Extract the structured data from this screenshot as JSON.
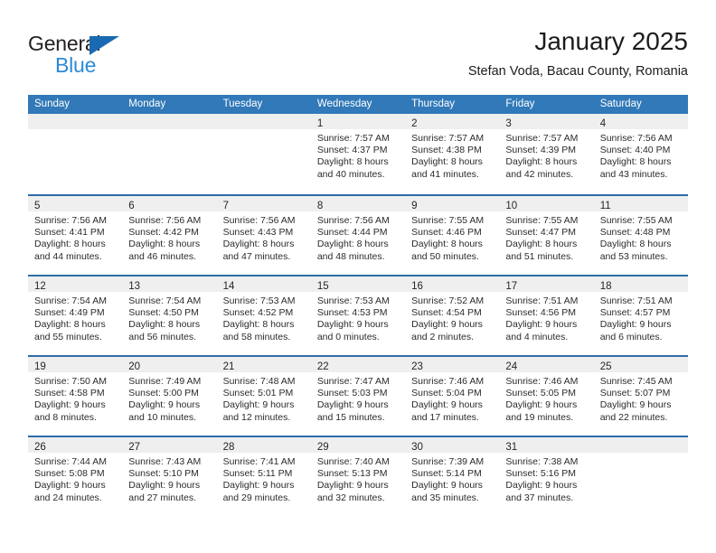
{
  "branding": {
    "name_part1": "General",
    "name_part2": "Blue",
    "triangle_color": "#1a6ab3",
    "blue_color": "#2b8ad6"
  },
  "header": {
    "title": "January 2025",
    "subtitle": "Stefan Voda, Bacau County, Romania"
  },
  "theme": {
    "header_row_bg": "#3179b8",
    "week_divider": "#2f6ca8",
    "day_bar_bg": "#efefef"
  },
  "weekdays": [
    "Sunday",
    "Monday",
    "Tuesday",
    "Wednesday",
    "Thursday",
    "Friday",
    "Saturday"
  ],
  "weeks": [
    [
      {
        "day": "",
        "empty": true
      },
      {
        "day": "",
        "empty": true
      },
      {
        "day": "",
        "empty": true
      },
      {
        "day": "1",
        "sunrise": "Sunrise: 7:57 AM",
        "sunset": "Sunset: 4:37 PM",
        "daylight1": "Daylight: 8 hours",
        "daylight2": "and 40 minutes."
      },
      {
        "day": "2",
        "sunrise": "Sunrise: 7:57 AM",
        "sunset": "Sunset: 4:38 PM",
        "daylight1": "Daylight: 8 hours",
        "daylight2": "and 41 minutes."
      },
      {
        "day": "3",
        "sunrise": "Sunrise: 7:57 AM",
        "sunset": "Sunset: 4:39 PM",
        "daylight1": "Daylight: 8 hours",
        "daylight2": "and 42 minutes."
      },
      {
        "day": "4",
        "sunrise": "Sunrise: 7:56 AM",
        "sunset": "Sunset: 4:40 PM",
        "daylight1": "Daylight: 8 hours",
        "daylight2": "and 43 minutes."
      }
    ],
    [
      {
        "day": "5",
        "sunrise": "Sunrise: 7:56 AM",
        "sunset": "Sunset: 4:41 PM",
        "daylight1": "Daylight: 8 hours",
        "daylight2": "and 44 minutes."
      },
      {
        "day": "6",
        "sunrise": "Sunrise: 7:56 AM",
        "sunset": "Sunset: 4:42 PM",
        "daylight1": "Daylight: 8 hours",
        "daylight2": "and 46 minutes."
      },
      {
        "day": "7",
        "sunrise": "Sunrise: 7:56 AM",
        "sunset": "Sunset: 4:43 PM",
        "daylight1": "Daylight: 8 hours",
        "daylight2": "and 47 minutes."
      },
      {
        "day": "8",
        "sunrise": "Sunrise: 7:56 AM",
        "sunset": "Sunset: 4:44 PM",
        "daylight1": "Daylight: 8 hours",
        "daylight2": "and 48 minutes."
      },
      {
        "day": "9",
        "sunrise": "Sunrise: 7:55 AM",
        "sunset": "Sunset: 4:46 PM",
        "daylight1": "Daylight: 8 hours",
        "daylight2": "and 50 minutes."
      },
      {
        "day": "10",
        "sunrise": "Sunrise: 7:55 AM",
        "sunset": "Sunset: 4:47 PM",
        "daylight1": "Daylight: 8 hours",
        "daylight2": "and 51 minutes."
      },
      {
        "day": "11",
        "sunrise": "Sunrise: 7:55 AM",
        "sunset": "Sunset: 4:48 PM",
        "daylight1": "Daylight: 8 hours",
        "daylight2": "and 53 minutes."
      }
    ],
    [
      {
        "day": "12",
        "sunrise": "Sunrise: 7:54 AM",
        "sunset": "Sunset: 4:49 PM",
        "daylight1": "Daylight: 8 hours",
        "daylight2": "and 55 minutes."
      },
      {
        "day": "13",
        "sunrise": "Sunrise: 7:54 AM",
        "sunset": "Sunset: 4:50 PM",
        "daylight1": "Daylight: 8 hours",
        "daylight2": "and 56 minutes."
      },
      {
        "day": "14",
        "sunrise": "Sunrise: 7:53 AM",
        "sunset": "Sunset: 4:52 PM",
        "daylight1": "Daylight: 8 hours",
        "daylight2": "and 58 minutes."
      },
      {
        "day": "15",
        "sunrise": "Sunrise: 7:53 AM",
        "sunset": "Sunset: 4:53 PM",
        "daylight1": "Daylight: 9 hours",
        "daylight2": "and 0 minutes."
      },
      {
        "day": "16",
        "sunrise": "Sunrise: 7:52 AM",
        "sunset": "Sunset: 4:54 PM",
        "daylight1": "Daylight: 9 hours",
        "daylight2": "and 2 minutes."
      },
      {
        "day": "17",
        "sunrise": "Sunrise: 7:51 AM",
        "sunset": "Sunset: 4:56 PM",
        "daylight1": "Daylight: 9 hours",
        "daylight2": "and 4 minutes."
      },
      {
        "day": "18",
        "sunrise": "Sunrise: 7:51 AM",
        "sunset": "Sunset: 4:57 PM",
        "daylight1": "Daylight: 9 hours",
        "daylight2": "and 6 minutes."
      }
    ],
    [
      {
        "day": "19",
        "sunrise": "Sunrise: 7:50 AM",
        "sunset": "Sunset: 4:58 PM",
        "daylight1": "Daylight: 9 hours",
        "daylight2": "and 8 minutes."
      },
      {
        "day": "20",
        "sunrise": "Sunrise: 7:49 AM",
        "sunset": "Sunset: 5:00 PM",
        "daylight1": "Daylight: 9 hours",
        "daylight2": "and 10 minutes."
      },
      {
        "day": "21",
        "sunrise": "Sunrise: 7:48 AM",
        "sunset": "Sunset: 5:01 PM",
        "daylight1": "Daylight: 9 hours",
        "daylight2": "and 12 minutes."
      },
      {
        "day": "22",
        "sunrise": "Sunrise: 7:47 AM",
        "sunset": "Sunset: 5:03 PM",
        "daylight1": "Daylight: 9 hours",
        "daylight2": "and 15 minutes."
      },
      {
        "day": "23",
        "sunrise": "Sunrise: 7:46 AM",
        "sunset": "Sunset: 5:04 PM",
        "daylight1": "Daylight: 9 hours",
        "daylight2": "and 17 minutes."
      },
      {
        "day": "24",
        "sunrise": "Sunrise: 7:46 AM",
        "sunset": "Sunset: 5:05 PM",
        "daylight1": "Daylight: 9 hours",
        "daylight2": "and 19 minutes."
      },
      {
        "day": "25",
        "sunrise": "Sunrise: 7:45 AM",
        "sunset": "Sunset: 5:07 PM",
        "daylight1": "Daylight: 9 hours",
        "daylight2": "and 22 minutes."
      }
    ],
    [
      {
        "day": "26",
        "sunrise": "Sunrise: 7:44 AM",
        "sunset": "Sunset: 5:08 PM",
        "daylight1": "Daylight: 9 hours",
        "daylight2": "and 24 minutes."
      },
      {
        "day": "27",
        "sunrise": "Sunrise: 7:43 AM",
        "sunset": "Sunset: 5:10 PM",
        "daylight1": "Daylight: 9 hours",
        "daylight2": "and 27 minutes."
      },
      {
        "day": "28",
        "sunrise": "Sunrise: 7:41 AM",
        "sunset": "Sunset: 5:11 PM",
        "daylight1": "Daylight: 9 hours",
        "daylight2": "and 29 minutes."
      },
      {
        "day": "29",
        "sunrise": "Sunrise: 7:40 AM",
        "sunset": "Sunset: 5:13 PM",
        "daylight1": "Daylight: 9 hours",
        "daylight2": "and 32 minutes."
      },
      {
        "day": "30",
        "sunrise": "Sunrise: 7:39 AM",
        "sunset": "Sunset: 5:14 PM",
        "daylight1": "Daylight: 9 hours",
        "daylight2": "and 35 minutes."
      },
      {
        "day": "31",
        "sunrise": "Sunrise: 7:38 AM",
        "sunset": "Sunset: 5:16 PM",
        "daylight1": "Daylight: 9 hours",
        "daylight2": "and 37 minutes."
      },
      {
        "day": "",
        "empty": true
      }
    ]
  ]
}
